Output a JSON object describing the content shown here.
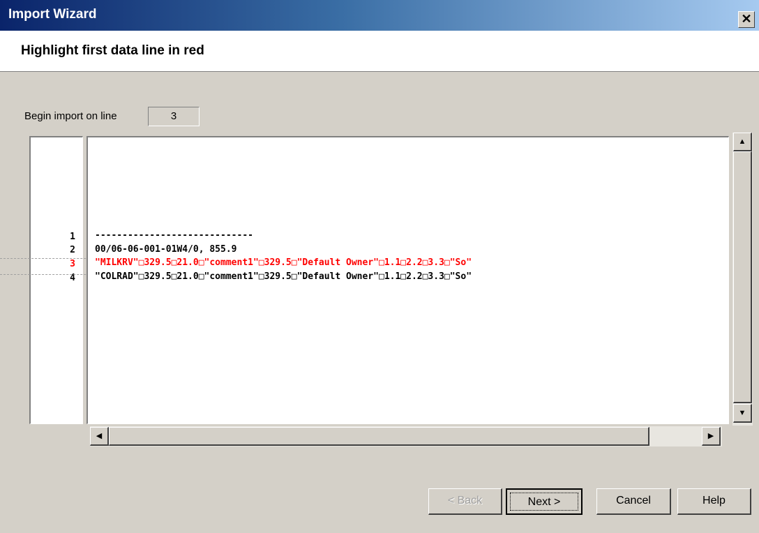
{
  "window": {
    "title": "Import Wizard",
    "close_glyph": "✕"
  },
  "header": {
    "heading": "Highlight first data line in red"
  },
  "begin_import": {
    "label": "Begin import on line",
    "value": "3"
  },
  "lines": [
    {
      "num": "1",
      "text": "-----------------------------"
    },
    {
      "num": "2",
      "text": "00/06-06-001-01W4/0, 855.9"
    },
    {
      "num": "3",
      "text": "\"MILKRV\"□329.5□21.0□\"comment1\"□329.5□\"Default Owner\"□1.1□2.2□3.3□\"So\""
    },
    {
      "num": "4",
      "text": "\"COLRAD\"□329.5□21.0□\"comment1\"□329.5□\"Default Owner\"□1.1□2.2□3.3□\"So\""
    }
  ],
  "highlight_color": "#ff0000",
  "scrollbar": {
    "up": "▲",
    "down": "▼",
    "left": "◀",
    "right": "▶"
  },
  "buttons": {
    "back": "< Back",
    "next": "Next >",
    "cancel": "Cancel",
    "help": "Help"
  }
}
